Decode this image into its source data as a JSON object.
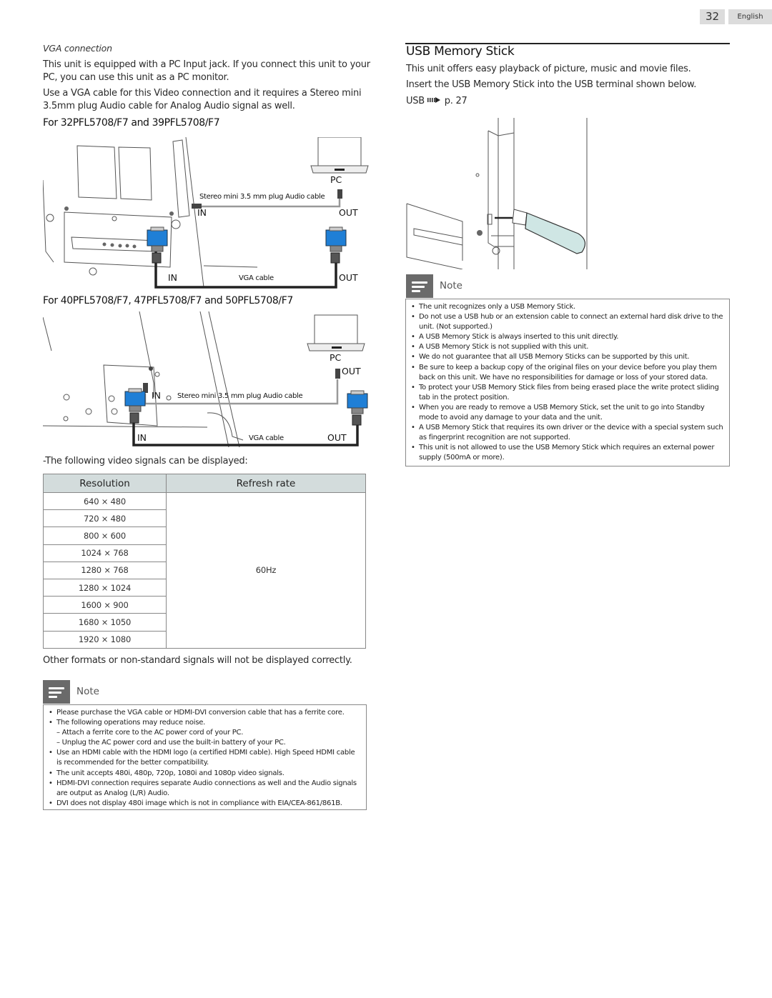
{
  "header": {
    "page_number": "32",
    "language": "English"
  },
  "left": {
    "section_heading": "VGA connection",
    "para1": "This unit is equipped with a PC Input jack. If you connect this unit to your PC, you can use this unit as a PC monitor.",
    "para2": "Use a VGA cable for this Video connection and it requires a Stereo mini 3.5mm plug Audio cable for Analog Audio signal as well.",
    "diagram1": {
      "title": "For 32PFL5708/F7 and 39PFL5708/F7",
      "pc_label": "PC",
      "audio_cable_label": "Stereo mini 3.5 mm plug Audio cable",
      "audio_in": "IN",
      "audio_out": "OUT",
      "vga_in": "IN",
      "vga_cable_label": "VGA cable",
      "vga_out": "OUT"
    },
    "diagram2": {
      "title": "For 40PFL5708/F7, 47PFL5708/F7 and 50PFL5708/F7",
      "pc_label": "PC",
      "audio_out": "OUT",
      "audio_in": "IN",
      "audio_cable_label": "Stereo mini 3.5 mm plug Audio cable",
      "vga_in": "IN",
      "vga_cable_label": "VGA cable",
      "vga_out": "OUT"
    },
    "signals_intro": "-The following video signals can be displayed:",
    "table": {
      "headers": [
        "Resolution",
        "Refresh rate"
      ],
      "resolutions": [
        "640 × 480",
        "720 × 480",
        "800 × 600",
        "1024 × 768",
        "1280 × 768",
        "1280 × 1024",
        "1600 × 900",
        "1680 × 1050",
        "1920 × 1080"
      ],
      "refresh_rate": "60Hz"
    },
    "other_formats": "Other formats or non-standard signals will not be displayed correctly.",
    "note": {
      "label": "Note",
      "items": [
        "Please purchase the VGA cable or HDMI-DVI conversion cable that has a ferrite core.",
        "The following operations may reduce noise.",
        "– Attach a ferrite core to the AC power cord of your PC.",
        "– Unplug the AC power cord and use the built-in battery of your PC.",
        "Use an HDMI cable with the HDMI logo (a certified HDMI cable). High Speed HDMI cable is recommended for the better compatibility.",
        "The unit accepts 480i, 480p, 720p, 1080i and 1080p video signals.",
        "HDMI-DVI connection requires separate Audio connections as well and the Audio signals are output as Analog (L/R) Audio.",
        "DVI does not display 480i image which is not in compliance with EIA/CEA-861/861B."
      ]
    }
  },
  "right": {
    "section_title": "USB Memory Stick",
    "para1": "This unit offers easy playback of picture, music and movie files.",
    "para2": "Insert the USB Memory Stick into the USB terminal shown below.",
    "ref_label": "USB",
    "ref_page": "p. 27",
    "note": {
      "label": "Note",
      "items": [
        "The unit recognizes only a USB Memory Stick.",
        "Do not use a USB hub or an extension cable to connect an external hard disk drive to the unit. (Not supported.)",
        "A USB Memory Stick is always inserted to this unit directly.",
        "A USB Memory Stick is not supplied with this unit.",
        "We do not guarantee that all USB Memory Sticks can be supported by this unit.",
        "Be sure to keep a backup copy of the original files on your device before you play them back on this unit. We have no responsibilities for damage or loss of your stored data.",
        "To protect your USB Memory Stick files from being erased place the write protect sliding tab in the protect position.",
        "When you are ready to remove a USB Memory Stick, set the unit to go into Standby mode to avoid any damage to your data and the unit.",
        "A USB Memory Stick that requires its own driver or the device with a special system such as fingerprint recognition are not supported.",
        "This unit is not allowed to use the USB Memory Stick which requires an external power supply (500mA or more)."
      ]
    }
  },
  "colors": {
    "connector_blue": "#1f7fd6",
    "table_header_bg": "#d3dcdc",
    "note_icon_bg": "#6a6a6a",
    "usb_stick": "#cfe6e4"
  }
}
